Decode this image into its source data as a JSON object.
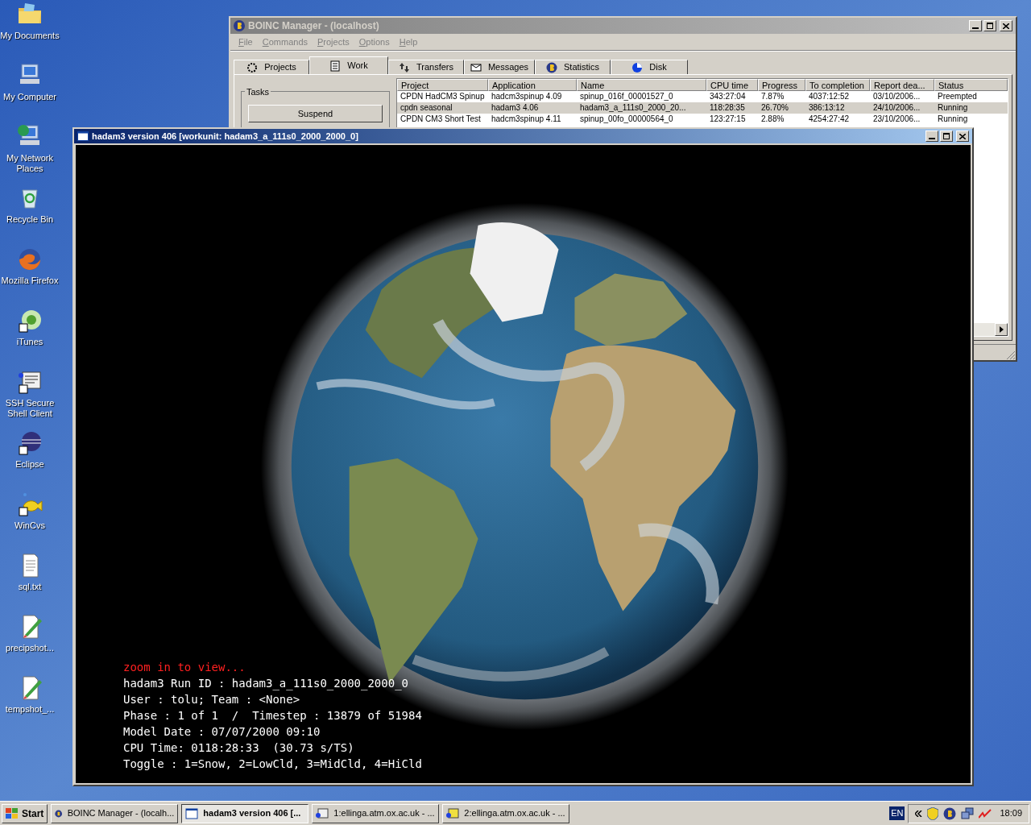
{
  "desktop_icons": [
    {
      "label": "My Documents"
    },
    {
      "label": "My Computer"
    },
    {
      "label": "My Network Places"
    },
    {
      "label": "Recycle Bin"
    },
    {
      "label": "Mozilla Firefox"
    },
    {
      "label": "iTunes"
    },
    {
      "label": "SSH Secure Shell Client"
    },
    {
      "label": "Eclipse"
    },
    {
      "label": "WinCvs"
    },
    {
      "label": "sql.txt"
    },
    {
      "label": "precipshot..."
    },
    {
      "label": "tempshot_..."
    }
  ],
  "boinc_window": {
    "title": "BOINC Manager - (localhost)",
    "active": false,
    "menu": [
      "File",
      "Commands",
      "Projects",
      "Options",
      "Help"
    ],
    "tabs": [
      {
        "label": "Projects",
        "selected": false
      },
      {
        "label": "Work",
        "selected": true
      },
      {
        "label": "Transfers",
        "selected": false
      },
      {
        "label": "Messages",
        "selected": false
      },
      {
        "label": "Statistics",
        "selected": false
      },
      {
        "label": "Disk",
        "selected": false
      }
    ],
    "tasks_group": {
      "title": "Tasks",
      "button": "Suspend"
    },
    "table": {
      "columns": [
        "Project",
        "Application",
        "Name",
        "CPU time",
        "Progress",
        "To completion",
        "Report dea...",
        "Status"
      ],
      "rows": [
        {
          "cells": [
            "CPDN HadCM3 Spinup",
            "hadcm3spinup 4.09",
            "spinup_016f_00001527_0",
            "343:27:04",
            "7.87%",
            "4037:12:52",
            "03/10/2006...",
            "Preempted"
          ],
          "selected": false
        },
        {
          "cells": [
            "cpdn seasonal",
            "hadam3 4.06",
            "hadam3_a_111s0_2000_20...",
            "118:28:35",
            "26.70%",
            "386:13:12",
            "24/10/2006...",
            "Running"
          ],
          "selected": true
        },
        {
          "cells": [
            "CPDN CM3 Short Test",
            "hadcm3spinup 4.11",
            "spinup_00fo_00000564_0",
            "123:27:15",
            "2.88%",
            "4254:27:42",
            "23/10/2006...",
            "Running"
          ],
          "selected": false
        }
      ]
    }
  },
  "graphics_window": {
    "title": "hadam3 version 406 [workunit: hadam3_a_111s0_2000_2000_0]",
    "active": true,
    "overlay_lines": [
      {
        "text": "zoom in to view...",
        "kind": "hint"
      },
      {
        "text": "hadam3 Run ID : hadam3_a_111s0_2000_2000_0",
        "kind": "info"
      },
      {
        "text": "User : tolu; Team : <None>",
        "kind": "info"
      },
      {
        "text": "Phase : 1 of 1  /  Timestep : 13879 of 51984",
        "kind": "info"
      },
      {
        "text": "Model Date : 07/07/2000 09:10",
        "kind": "info"
      },
      {
        "text": "CPU Time: 0118:28:33  (30.73 s/TS)",
        "kind": "info"
      },
      {
        "text": "Toggle : 1=Snow, 2=LowCld, 3=MidCld, 4=HiCld",
        "kind": "info"
      }
    ]
  },
  "taskbar": {
    "start": "Start",
    "buttons": [
      {
        "label": "BOINC Manager - (localh...",
        "selected": false
      },
      {
        "label": "hadam3 version 406 [...",
        "selected": true
      },
      {
        "label": "1:ellinga.atm.ox.ac.uk - ...",
        "selected": false
      },
      {
        "label": "2:ellinga.atm.ox.ac.uk - ...",
        "selected": false
      }
    ],
    "language": "EN",
    "clock": "18:09"
  }
}
